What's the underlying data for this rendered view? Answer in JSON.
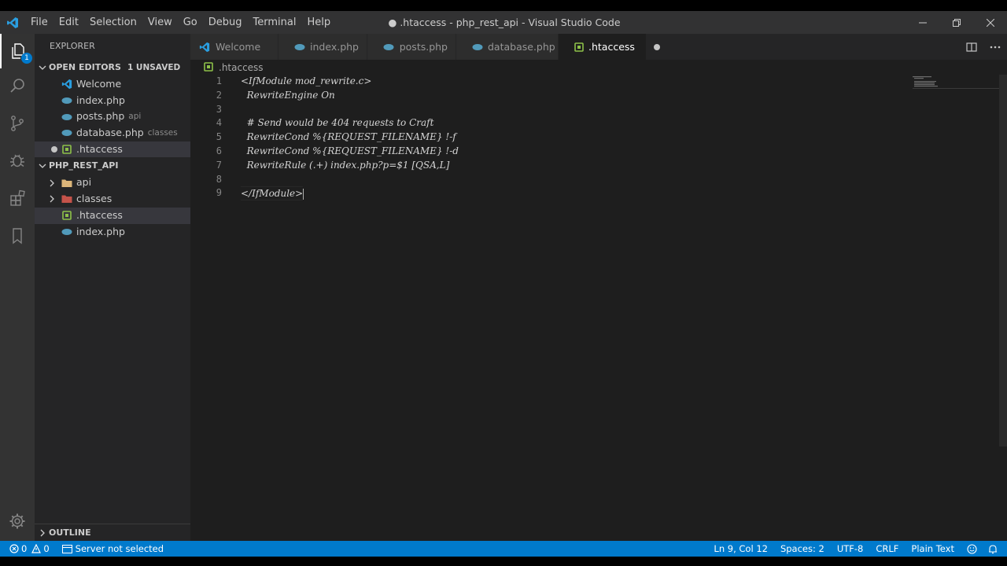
{
  "window": {
    "title": "● .htaccess - php_rest_api - Visual Studio Code"
  },
  "menu": [
    "File",
    "Edit",
    "Selection",
    "View",
    "Go",
    "Debug",
    "Terminal",
    "Help"
  ],
  "activity_bar": {
    "explorer_badge": "1",
    "items": [
      "explorer-icon",
      "search-icon",
      "source-control-icon",
      "debug-icon",
      "extensions-icon",
      "bookmark-icon"
    ],
    "bottom": "gear-icon"
  },
  "sidebar": {
    "title": "EXPLORER",
    "open_editors": {
      "label": "OPEN EDITORS",
      "badge": "1 UNSAVED",
      "items": [
        {
          "name": "Welcome",
          "hint": ""
        },
        {
          "name": "index.php",
          "hint": ""
        },
        {
          "name": "posts.php",
          "hint": "api"
        },
        {
          "name": "database.php",
          "hint": "classes"
        },
        {
          "name": ".htaccess",
          "hint": ""
        }
      ]
    },
    "project": {
      "label": "PHP_REST_API",
      "items": [
        {
          "name": "api",
          "type": "folder"
        },
        {
          "name": "classes",
          "type": "folder"
        },
        {
          "name": ".htaccess",
          "type": "file"
        },
        {
          "name": "index.php",
          "type": "file"
        }
      ]
    },
    "outline_label": "OUTLINE"
  },
  "tabs": [
    {
      "label": "Welcome",
      "icon": "vscode-icon"
    },
    {
      "label": "index.php",
      "icon": "php-icon"
    },
    {
      "label": "posts.php",
      "icon": "php-icon"
    },
    {
      "label": "database.php",
      "icon": "php-icon"
    },
    {
      "label": ".htaccess",
      "icon": "htaccess-icon",
      "active": true
    }
  ],
  "breadcrumb": ".htaccess",
  "editor": {
    "lines": [
      "<IfModule mod_rewrite.c>",
      "  RewriteEngine On",
      "",
      "  # Send would be 404 requests to Craft",
      "  RewriteCond %{REQUEST_FILENAME} !-f",
      "  RewriteCond %{REQUEST_FILENAME} !-d",
      "  RewriteRule (.+) index.php?p=$1 [QSA,L]",
      "",
      "</IfModule>"
    ],
    "line_numbers": [
      "1",
      "2",
      "3",
      "4",
      "5",
      "6",
      "7",
      "8",
      "9"
    ]
  },
  "statusbar": {
    "errors": "0",
    "warnings": "0",
    "server": "Server not selected",
    "position": "Ln 9, Col 12",
    "spaces": "Spaces: 2",
    "encoding": "UTF-8",
    "eol": "CRLF",
    "language": "Plain Text"
  },
  "colors": {
    "accent": "#007acc",
    "php_icon": "#519aba",
    "htaccess_icon": "#8dc149",
    "folder_api": "#dcb67a",
    "folder_classes": "#c5534a"
  }
}
